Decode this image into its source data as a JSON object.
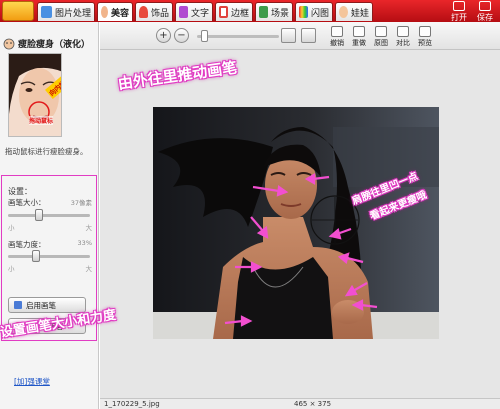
{
  "colors": {
    "topbar": "#c8171b",
    "annotation": "#e13cc3",
    "arrow": "#f24fd0",
    "link": "#1f56c7"
  },
  "topbar": {
    "tabs": [
      {
        "label": "图片处理",
        "icon": "image-process-icon"
      },
      {
        "label": "美容",
        "icon": "beauty-face-icon"
      },
      {
        "label": "饰品",
        "icon": "heart-accessory-icon"
      },
      {
        "label": "文字",
        "icon": "text-icon"
      },
      {
        "label": "边框",
        "icon": "frame-icon"
      },
      {
        "label": "场景",
        "icon": "scene-icon"
      },
      {
        "label": "闪图",
        "icon": "flash-icon"
      },
      {
        "label": "娃娃",
        "icon": "doll-icon"
      }
    ],
    "active_tab": "美容",
    "open_label": "打开",
    "save_label": "保存"
  },
  "left_panel": {
    "title": "瘦脸瘦身（液化）",
    "thumb_badge_top": "向内推",
    "thumb_badge_mouse": "拖动鼠标",
    "description": "拖动鼠标进行瘦脸瘦身。",
    "settings_title": "设置：",
    "brush_size_label": "画笔大小：",
    "brush_size_value": "37像素",
    "brush_size_level": 0.37,
    "brush_force_label": "画笔力度：",
    "brush_force_value": "33%",
    "brush_force_level": 0.33,
    "min_label": "小",
    "max_label": "大",
    "enable_brush_label": "启用画笔",
    "back_label": "返回到美容",
    "footer_link": "[加]强课堂"
  },
  "workspace": {
    "tools": [
      {
        "label": "撤销",
        "icon": "undo-icon"
      },
      {
        "label": "重做",
        "icon": "redo-icon"
      },
      {
        "label": "原图",
        "icon": "original-image-icon"
      },
      {
        "label": "对比",
        "icon": "compare-icon"
      },
      {
        "label": "预览",
        "icon": "preview-icon"
      }
    ],
    "zoom_level": 0.05
  },
  "status": {
    "filename": "1_170229_5.jpg",
    "dimensions": "465 × 375"
  },
  "annotations": {
    "top": "由外往里推动画笔",
    "shoulder_line1": "肩膀往里凹一点",
    "shoulder_line2": "看起来更瘦哦",
    "bottom": "设置画笔大小和力度"
  }
}
